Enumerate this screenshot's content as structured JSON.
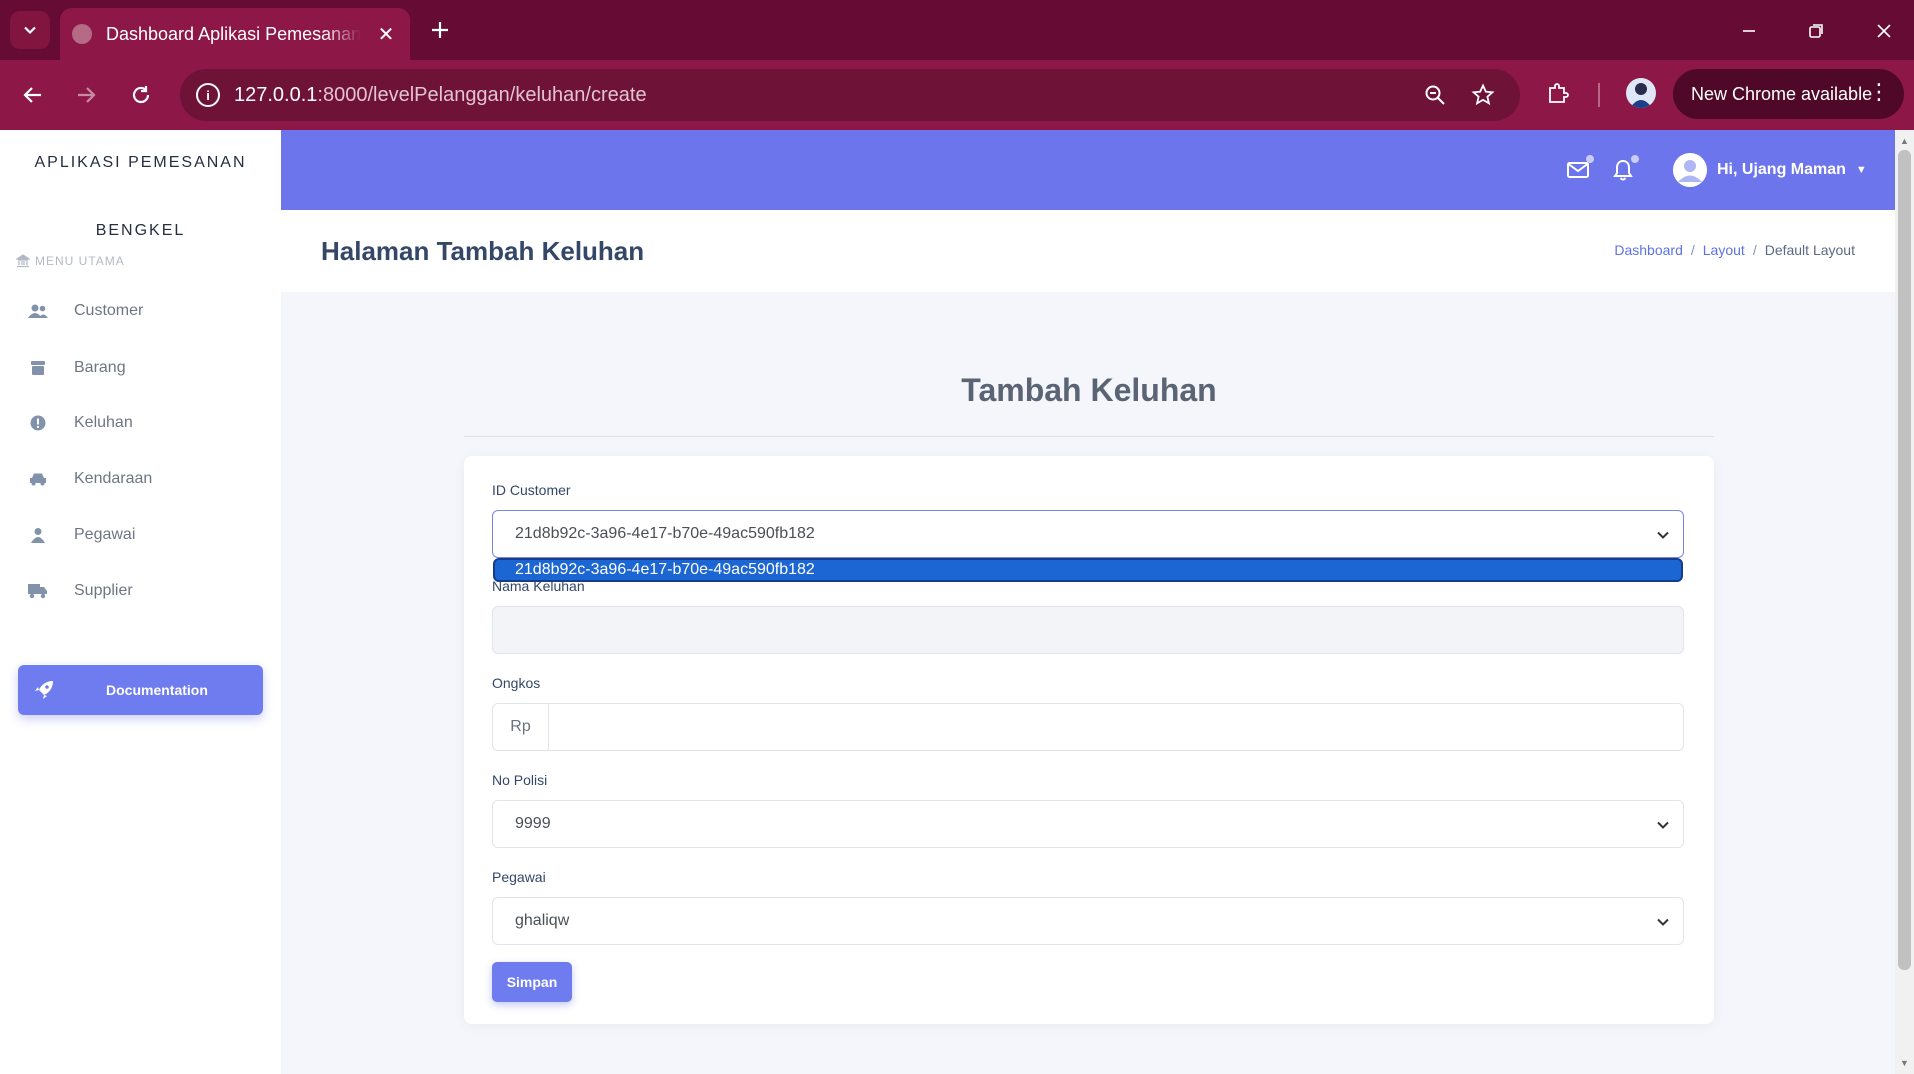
{
  "browser": {
    "tab_title": "Dashboard Aplikasi Pemesanan",
    "url_host": "127.0.0.1",
    "url_path": ":8000/levelPelanggan/keluhan/create",
    "update_label": "New Chrome available"
  },
  "sidebar": {
    "brand_line1": "APLIKASI PEMESANAN",
    "brand_line2": "BENGKEL",
    "menu_heading": "MENU UTAMA",
    "items": [
      {
        "label": "Customer",
        "icon": "users-icon"
      },
      {
        "label": "Barang",
        "icon": "box-icon"
      },
      {
        "label": "Keluhan",
        "icon": "exclamation-circle-icon"
      },
      {
        "label": "Kendaraan",
        "icon": "car-icon"
      },
      {
        "label": "Pegawai",
        "icon": "user-icon"
      },
      {
        "label": "Supplier",
        "icon": "truck-icon"
      }
    ],
    "documentation_label": "Documentation"
  },
  "topbar": {
    "user_greeting": "Hi, Ujang Maman"
  },
  "header": {
    "title": "Halaman Tambah Keluhan",
    "breadcrumb": [
      "Dashboard",
      "Layout",
      "Default Layout"
    ]
  },
  "form": {
    "heading": "Tambah Keluhan",
    "id_customer": {
      "label": "ID Customer",
      "value": "21d8b92c-3a96-4e17-b70e-49ac590fb182",
      "open_option": "21d8b92c-3a96-4e17-b70e-49ac590fb182"
    },
    "nama_keluhan": {
      "label": "Nama Keluhan",
      "value": ""
    },
    "ongkos": {
      "label": "Ongkos",
      "prefix": "Rp",
      "value": ""
    },
    "no_polisi": {
      "label": "No Polisi",
      "value": "9999"
    },
    "pegawai": {
      "label": "Pegawai",
      "value": "ghaliqw"
    },
    "submit_label": "Simpan"
  },
  "colors": {
    "accent": "#6d75ec",
    "browser_frame": "#8d1848",
    "dropdown_highlight": "#1b66d2"
  }
}
